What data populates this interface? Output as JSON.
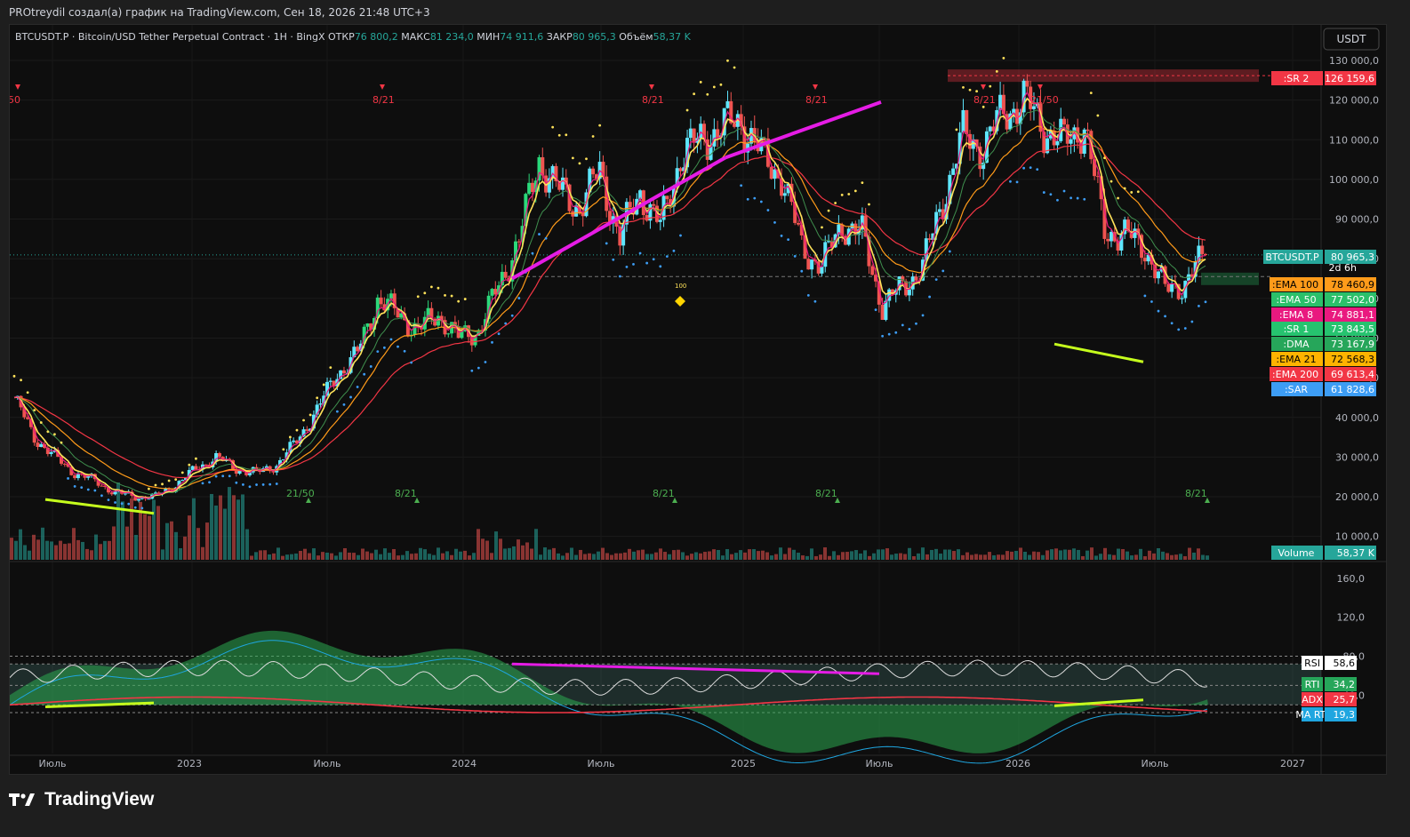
{
  "caption": "PROtreydil создал(а) график на TradingView.com, Сен 18, 2026 21:48 UTC+3",
  "legend": {
    "symbol": "BTCUSDT.P · Bitcoin/USD Tether Perpetual Contract · 1H · BingX",
    "open_label": "ОТКР",
    "open": "76 800,2",
    "high_label": "МАКС",
    "high": "81 234,0",
    "low_label": "МИН",
    "low": "74 911,6",
    "close_label": "ЗАКР",
    "close": "80 965,3",
    "volume_label": "Объём",
    "volume": "58,37 K"
  },
  "currency_button": "USDT",
  "brand": "TradingView",
  "colors": {
    "up": "#26a69a",
    "down": "#ef5350",
    "cyan": "#5ee7ff",
    "magenta": "#e51ce5",
    "yellowgreen": "#c6ff1d",
    "ema8": "#e9197f",
    "ema21": "#ffe25a",
    "ema50": "#2bc06a",
    "ema100": "#ff9b1a",
    "ema200": "#f23645",
    "sar": "#3d9df5"
  },
  "chart_data": {
    "type": "line",
    "title": "",
    "price_axis": {
      "ticks": [
        "130 000,0",
        "120 000,0",
        "110 000,0",
        "100 000,0",
        "90 000,0",
        "80 000,0",
        "70 000,0",
        "60 000,0",
        "50 000,0",
        "40 000,0",
        "30 000,0",
        "20 000,0",
        "10 000,0"
      ],
      "values": [
        130000,
        120000,
        110000,
        100000,
        90000,
        80000,
        70000,
        60000,
        50000,
        40000,
        30000,
        20000,
        10000
      ]
    },
    "time_axis": {
      "ticks": [
        "Июль",
        "2023",
        "Июль",
        "2024",
        "Июль",
        "2025",
        "Июль",
        "2026",
        "Июль",
        "2027"
      ]
    },
    "oscillator_axis": {
      "ticks": [
        "160,0",
        "120,0",
        "80,0",
        "40,0"
      ],
      "values": [
        160,
        120,
        80,
        40
      ]
    },
    "price_series": [
      {
        "name": "BTCUSDT.P",
        "value": 80965.3,
        "value_label": "80 965,3",
        "countdown": "2d 6h",
        "color": "#26a69a"
      },
      {
        "name": ":EMA 100",
        "value": 78460.9,
        "value_label": "78 460,9",
        "color": "#ff9b1a"
      },
      {
        "name": ":EMA 50",
        "value": 77502.0,
        "value_label": "77 502,0",
        "color": "#2bc06a"
      },
      {
        "name": ":EMA 8",
        "value": 74881.1,
        "value_label": "74 881,1",
        "color": "#e9197f"
      },
      {
        "name": ":SR 1",
        "value": 73843.5,
        "value_label": "73 843,5",
        "color": "#26c36f"
      },
      {
        "name": ":DMA",
        "value": 73167.9,
        "value_label": "73 167,9",
        "color": "#26a65a"
      },
      {
        "name": ":EMA 21",
        "value": 72568.3,
        "value_label": "72 568,3",
        "color": "#ffb300"
      },
      {
        "name": ":EMA 200",
        "value": 69613.4,
        "value_label": "69 613,4",
        "color": "#f23645"
      },
      {
        "name": ":SAR",
        "value": 61828.6,
        "value_label": "61 828,6",
        "color": "#3d9df5"
      }
    ],
    "sr2": {
      "name": ":SR 2",
      "value": 126159.6,
      "value_label": "126 159,6"
    },
    "volume": {
      "name": "Volume",
      "value_label": "58,37 K"
    },
    "oscillators": [
      {
        "name": "RSI",
        "value": 58.6,
        "value_label": "58,6",
        "color": "#ffffff"
      },
      {
        "name": "RTI",
        "value": 34.2,
        "value_label": "34,2",
        "color": "#26a65a"
      },
      {
        "name": "ADX",
        "value": 25.7,
        "value_label": "25,7",
        "color": "#f23645"
      },
      {
        "name": "MA RTI",
        "value": 19.3,
        "value_label": "19,3",
        "color": "#1fa6e0"
      }
    ],
    "signals_top": [
      "50",
      "8/21",
      "8/21",
      "8/21",
      "8/21",
      "21/50"
    ],
    "signals_bottom": [
      "21/50",
      "8/21",
      "8/21",
      "8/21",
      "8/21"
    ],
    "marker_100": "100",
    "monthly_closes": [
      45,
      35,
      30,
      26,
      24,
      21,
      20,
      20,
      23,
      27,
      30,
      27,
      26,
      28,
      34,
      42,
      51,
      56,
      70,
      66,
      62,
      66,
      60,
      62,
      73,
      85,
      105,
      97,
      93,
      102,
      85,
      97,
      88,
      106,
      110,
      113,
      115,
      106,
      101,
      83,
      78,
      89,
      86,
      68,
      73,
      78,
      95,
      111,
      108,
      117,
      120,
      113,
      109,
      114,
      87,
      86,
      83,
      72,
      74,
      81
    ]
  }
}
